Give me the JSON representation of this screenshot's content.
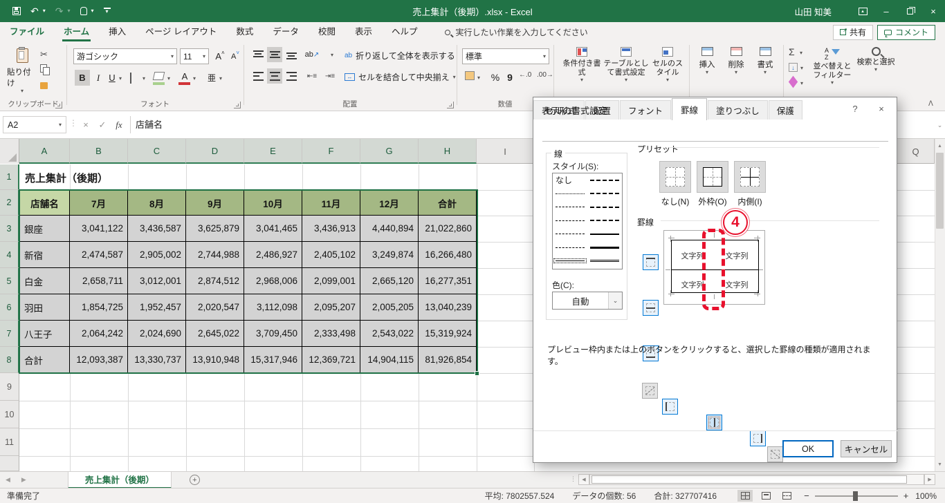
{
  "colors": {
    "brand": "#217346",
    "selection": "#1e7145",
    "annotation": "#e8112d",
    "header_fill": "#a4b884",
    "active_cell_fill": "#c5d7a6"
  },
  "titlebar": {
    "title": "売上集計（後期）.xlsx - Excel",
    "user": "山田 知美"
  },
  "tabs": {
    "items": [
      "ファイル",
      "ホーム",
      "挿入",
      "ページ レイアウト",
      "数式",
      "データ",
      "校閲",
      "表示",
      "ヘルプ"
    ],
    "active": "ホーム",
    "search": "実行したい作業を入力してください",
    "share": "共有",
    "comment": "コメント"
  },
  "ribbon": {
    "clipboard": {
      "label": "クリップボード",
      "paste": "貼り付け"
    },
    "font": {
      "label": "フォント",
      "name": "游ゴシック",
      "size": "11"
    },
    "align": {
      "label": "配置",
      "wrap": "折り返して全体を表示する",
      "merge": "セルを結合して中央揃え"
    },
    "number": {
      "label": "数値",
      "format": "標準"
    },
    "styles": {
      "conditional": "条件付き書式",
      "as_table": "テーブルとして書式設定",
      "cell_styles": "セルのスタイル"
    },
    "cells": {
      "insert": "挿入",
      "del": "削除",
      "format": "書式"
    },
    "editing": {
      "sort": "並べ替えとフィルター",
      "find": "検索と選択"
    }
  },
  "glyphs": {
    "bold": "B",
    "italic": "I",
    "underline": "U",
    "font_color": "A",
    "phonetic": "亜",
    "grow": "A",
    "shrink": "A",
    "wrap": "ab",
    "sigma": "Σ",
    "percent": "%",
    "comma": "9",
    "dec0": "←.0",
    "dec00": ".00→",
    "sortA": "A",
    "sortZ": "Z"
  },
  "icons": {
    "dropdown": "▾",
    "up": "▲",
    "down": "▼",
    "left": "◀",
    "right": "▶",
    "close": "×",
    "help": "?",
    "check": "✓",
    "x": "×",
    "undo": "↶",
    "redo": "↷",
    "minimize": "–",
    "chevron_up": "ᐱ",
    "chevron_down": "⌄",
    "plus": "+",
    "minus": "−",
    "dots": "⋮",
    "new": "+"
  },
  "formula": {
    "name_box": "A2",
    "value": "店舗名",
    "fx": "fx"
  },
  "sheet": {
    "col_heads": [
      "A",
      "B",
      "C",
      "D",
      "E",
      "F",
      "G",
      "H",
      "I"
    ],
    "far_col": "Q",
    "row_heads": [
      "1",
      "2",
      "3",
      "4",
      "5",
      "6",
      "7",
      "8",
      "9",
      "10",
      "11"
    ],
    "title_cell": "売上集計（後期）",
    "table": {
      "headers": [
        "店舗名",
        "7月",
        "8月",
        "9月",
        "10月",
        "11月",
        "12月",
        "合計"
      ],
      "rows": [
        [
          "銀座",
          "3,041,122",
          "3,436,587",
          "3,625,879",
          "3,041,465",
          "3,436,913",
          "4,440,894",
          "21,022,860"
        ],
        [
          "新宿",
          "2,474,587",
          "2,905,002",
          "2,744,988",
          "2,486,927",
          "2,405,102",
          "3,249,874",
          "16,266,480"
        ],
        [
          "白金",
          "2,658,711",
          "3,012,001",
          "2,874,512",
          "2,968,006",
          "2,099,001",
          "2,665,120",
          "16,277,351"
        ],
        [
          "羽田",
          "1,854,725",
          "1,952,457",
          "2,020,547",
          "3,112,098",
          "2,095,207",
          "2,005,205",
          "13,040,239"
        ],
        [
          "八王子",
          "2,064,242",
          "2,024,690",
          "2,645,022",
          "3,709,450",
          "2,333,498",
          "2,543,022",
          "15,319,924"
        ],
        [
          "合計",
          "12,093,387",
          "13,330,737",
          "13,910,948",
          "15,317,946",
          "12,369,721",
          "14,904,115",
          "81,926,854"
        ]
      ]
    }
  },
  "dialog": {
    "title": "セルの書式設定",
    "tabs": [
      "表示形式",
      "配置",
      "フォント",
      "罫線",
      "塗りつぶし",
      "保護"
    ],
    "active_tab": "罫線",
    "line": {
      "label": "線",
      "style": "スタイル(S):",
      "none": "なし",
      "color": "色(C):",
      "auto": "自動"
    },
    "preset": {
      "label": "プリセット",
      "none": "なし(N)",
      "outline": "外枠(O)",
      "inside": "内側(I)"
    },
    "border": {
      "label": "罫線",
      "text": "文字列",
      "badge": "4"
    },
    "hint": "プレビュー枠内または上のボタンをクリックすると、選択した罫線の種類が適用されます。",
    "ok": "OK",
    "cancel": "キャンセル"
  },
  "sheet_tabs": {
    "active": "売上集計（後期）"
  },
  "status": {
    "ready": "準備完了",
    "avg": "平均: 7802557.524",
    "count": "データの個数: 56",
    "sum": "合計: 327707416",
    "zoom": "100%"
  }
}
